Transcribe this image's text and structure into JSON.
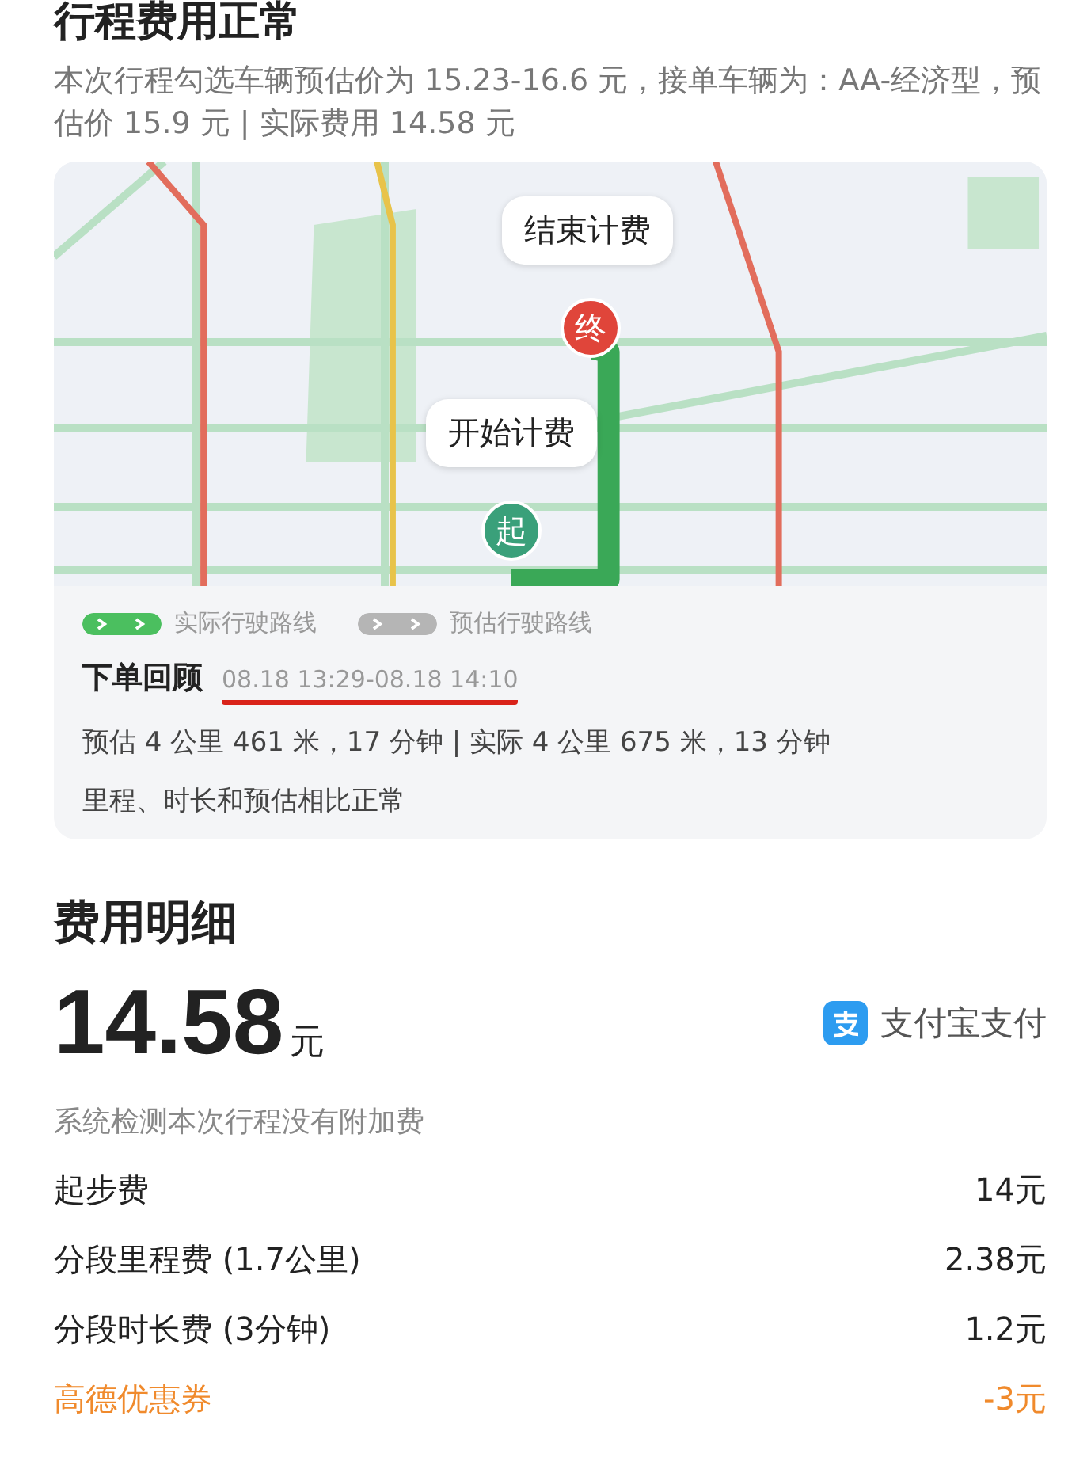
{
  "header": {
    "title": "行程费用正常",
    "description": "本次行程勾选车辆预估价为 15.23-16.6 元，接单车辆为：AA-经济型，预估价 15.9 元 | 实际费用 14.58 元"
  },
  "map": {
    "markers": [
      {
        "kind": "end",
        "badge": "终",
        "callout": "结束计费"
      },
      {
        "kind": "start",
        "badge": "起",
        "callout": "开始计费"
      }
    ]
  },
  "legend": [
    {
      "kind": "actual",
      "label": "实际行驶路线"
    },
    {
      "kind": "estimated",
      "label": "预估行驶路线"
    }
  ],
  "review": {
    "title": "下单回顾",
    "time_range": "08.18 13:29-08.18 14:10",
    "underlined": true,
    "summary": "预估 4 公里 461 米，17 分钟 | 实际 4 公里 675 米，13 分钟",
    "verdict": "里程、时长和预估相比正常"
  },
  "fees": {
    "title": "费用明细",
    "total": "14.58",
    "currency": "元",
    "payment": "支付宝支付",
    "note": "系统检测本次行程没有附加费",
    "items": [
      {
        "kind": "charge",
        "label": "起步费",
        "amount": "14元"
      },
      {
        "kind": "charge",
        "label": "分段里程费 (1.7公里)",
        "amount": "2.38元"
      },
      {
        "kind": "charge",
        "label": "分段时长费 (3分钟)",
        "amount": "1.2元"
      },
      {
        "kind": "discount",
        "label": "高德优惠券",
        "amount": "-3元"
      }
    ]
  }
}
